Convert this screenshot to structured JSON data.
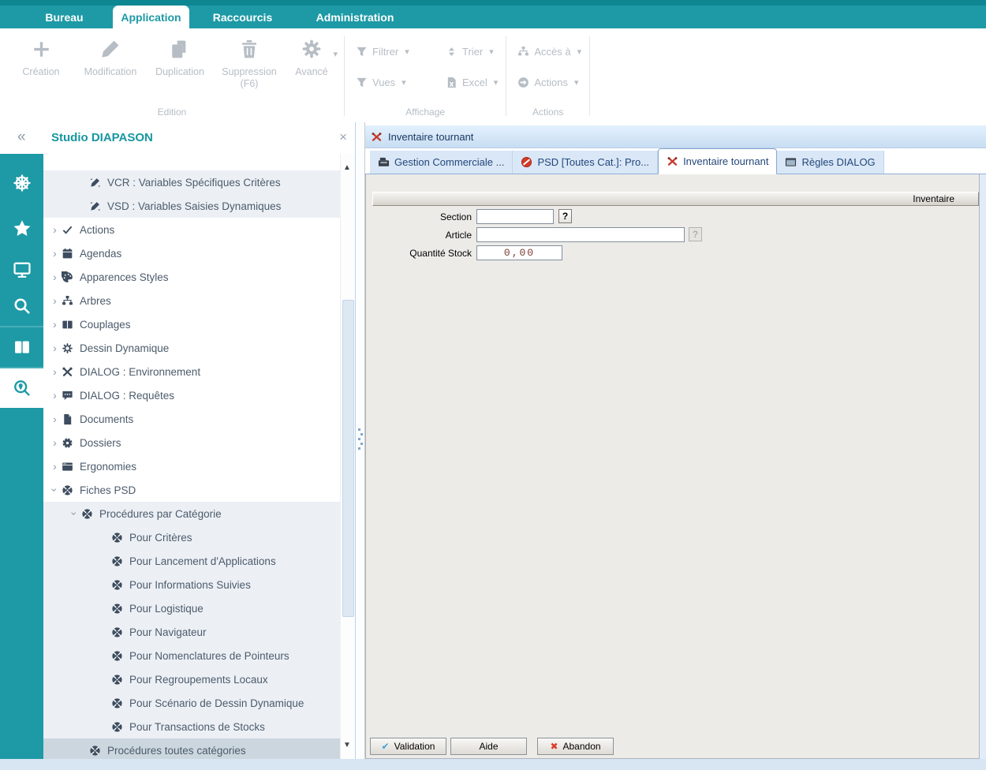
{
  "menu": {
    "tabs": [
      {
        "label": "Bureau",
        "active": false
      },
      {
        "label": "Application",
        "active": true
      },
      {
        "label": "Raccourcis",
        "active": false
      },
      {
        "label": "Administration",
        "active": false
      }
    ]
  },
  "toolbar": {
    "groups": [
      {
        "label": "Edition",
        "items": [
          {
            "label": "Création",
            "icon": "plus-icon",
            "symbol": "#i-plus"
          },
          {
            "label": "Modification",
            "icon": "pencil-icon",
            "symbol": "#i-pencil"
          },
          {
            "label": "Duplication",
            "icon": "duplicate-icon",
            "symbol": "#i-dup"
          },
          {
            "label": "Suppression",
            "sub": "(F6)",
            "icon": "trash-icon",
            "symbol": "#i-trash"
          },
          {
            "label": "Avancé",
            "icon": "gear-icon",
            "symbol": "#i-gear",
            "dropdown": "▾"
          }
        ]
      },
      {
        "label": "Affichage",
        "items": [
          {
            "label": "Filtrer",
            "icon": "filter-icon",
            "symbol": "#i-filter",
            "dropdown": "▾"
          },
          {
            "label": "Trier",
            "icon": "sort-icon",
            "symbol": "#i-sort",
            "dropdown": "▾"
          },
          {
            "label": "Vues",
            "icon": "filter-icon",
            "symbol": "#i-filter",
            "dropdown": "▾"
          },
          {
            "label": "Excel",
            "icon": "excel-icon",
            "symbol": "#i-excel",
            "dropdown": "▾"
          }
        ]
      },
      {
        "label": "Actions",
        "items": [
          {
            "label": "Accès à",
            "icon": "org-tree-icon",
            "symbol": "#i-orgtree",
            "dropdown": "▾"
          },
          {
            "label": "Actions",
            "icon": "arrow-circle-icon",
            "symbol": "#i-arrowc",
            "dropdown": "▾"
          }
        ]
      }
    ]
  },
  "sidebar": {
    "collapse_glyph": "«",
    "title": "Studio DIAPASON",
    "close_glyph": "×",
    "rail": [
      {
        "icon": "helm-icon",
        "symbol": "#i-helm",
        "active": false
      },
      {
        "icon": "star-icon",
        "symbol": "#i-star",
        "active": false
      },
      {
        "icon": "monitor-icon",
        "symbol": "#i-monitor",
        "active": false
      },
      {
        "icon": "search-icon",
        "symbol": "#i-search",
        "active": false
      },
      {
        "icon": "columns-icon",
        "symbol": "#i-cols",
        "active": false
      },
      {
        "icon": "search-pin-icon",
        "symbol": "#i-searchpin",
        "active": true
      }
    ],
    "scroll": {
      "up_glyph": "▲",
      "down_glyph": "▼"
    },
    "tree": [
      {
        "label": "VCR : Variables Spécifiques Critères",
        "icon": "i-vars",
        "level": "2c",
        "chevron": "",
        "state": "hl"
      },
      {
        "label": "VSD : Variables Saisies Dynamiques",
        "icon": "i-vars",
        "level": "2c",
        "chevron": "",
        "state": "hl"
      },
      {
        "label": "Actions",
        "icon": "i-check",
        "level": "1",
        "chevron": "right",
        "state": ""
      },
      {
        "label": "Agendas",
        "icon": "i-cal",
        "level": "1",
        "chevron": "right",
        "state": ""
      },
      {
        "label": "Apparences Styles",
        "icon": "i-palette",
        "level": "1",
        "chevron": "right",
        "state": ""
      },
      {
        "label": "Arbres",
        "icon": "i-orgtree",
        "level": "1",
        "chevron": "right",
        "state": ""
      },
      {
        "label": "Couplages",
        "icon": "i-cols2",
        "level": "1",
        "chevron": "right",
        "state": ""
      },
      {
        "label": "Dessin Dynamique",
        "icon": "i-gearo",
        "level": "1",
        "chevron": "right",
        "state": ""
      },
      {
        "label": "DIALOG : Environnement",
        "icon": "i-tools",
        "level": "1",
        "chevron": "right",
        "state": ""
      },
      {
        "label": "DIALOG : Requêtes",
        "icon": "i-chat",
        "level": "1",
        "chevron": "right",
        "state": ""
      },
      {
        "label": "Documents",
        "icon": "i-file",
        "level": "1",
        "chevron": "right",
        "state": ""
      },
      {
        "label": "Dossiers",
        "icon": "i-wheel",
        "level": "1",
        "chevron": "right",
        "state": ""
      },
      {
        "label": "Ergonomies",
        "icon": "i-window",
        "level": "1",
        "chevron": "right",
        "state": ""
      },
      {
        "label": "Fiches PSD",
        "icon": "i-psd",
        "level": "1",
        "chevron": "down",
        "state": ""
      },
      {
        "label": "Procédures par Catégorie",
        "icon": "i-psd",
        "level": "2",
        "chevron": "down",
        "state": "hl"
      },
      {
        "label": "Pour Critères",
        "icon": "i-psd",
        "level": "3",
        "chevron": "",
        "state": "hl"
      },
      {
        "label": "Pour Lancement d'Applications",
        "icon": "i-psd",
        "level": "3",
        "chevron": "",
        "state": "hl"
      },
      {
        "label": "Pour Informations Suivies",
        "icon": "i-psd",
        "level": "3",
        "chevron": "",
        "state": "hl"
      },
      {
        "label": "Pour Logistique",
        "icon": "i-psd",
        "level": "3",
        "chevron": "",
        "state": "hl"
      },
      {
        "label": "Pour Navigateur",
        "icon": "i-psd",
        "level": "3",
        "chevron": "",
        "state": "hl"
      },
      {
        "label": "Pour Nomenclatures de Pointeurs",
        "icon": "i-psd",
        "level": "3",
        "chevron": "",
        "state": "hl"
      },
      {
        "label": "Pour Regroupements Locaux",
        "icon": "i-psd",
        "level": "3",
        "chevron": "",
        "state": "hl"
      },
      {
        "label": "Pour Scénario de Dessin Dynamique",
        "icon": "i-psd",
        "level": "3",
        "chevron": "",
        "state": "hl"
      },
      {
        "label": "Pour Transactions de Stocks",
        "icon": "i-psd",
        "level": "3",
        "chevron": "",
        "state": "hl"
      },
      {
        "label": "Procédures toutes catégories",
        "icon": "i-psd",
        "level": "2c",
        "chevron": "",
        "state": "sel"
      }
    ]
  },
  "main": {
    "window_title": "Inventaire tournant",
    "window_icon": "inventory-tools-icon",
    "tabs": [
      {
        "label": "Gestion Commerciale ...",
        "icon": "register-icon",
        "symbol": "#i-register",
        "active": false
      },
      {
        "label": "PSD [Toutes Cat.]: Pro...",
        "icon": "no-entry-icon",
        "symbol": "#i-noentry",
        "active": false
      },
      {
        "label": "Inventaire tournant",
        "icon": "inventory-tools-icon",
        "symbol": "#i-invtools",
        "active": true
      },
      {
        "label": "Règles DIALOG",
        "icon": "console-icon",
        "symbol": "#i-console",
        "active": false
      }
    ],
    "form": {
      "group_title": "Inventaire",
      "fields": [
        {
          "label": "Section",
          "value": "",
          "help_button": "?",
          "help_enabled": true
        },
        {
          "label": "Article",
          "value": "",
          "help_button": "?",
          "help_enabled": false
        },
        {
          "label": "Quantité Stock",
          "value": "0,00"
        }
      ]
    },
    "buttons": [
      {
        "label": "Validation",
        "glyph": "✔",
        "icon": "check-icon"
      },
      {
        "label": "Aide",
        "glyph": "",
        "icon": ""
      },
      {
        "label": "Abandon",
        "glyph": "✖",
        "icon": "x-icon"
      }
    ]
  },
  "colors": {
    "teal": "#1d9aa6",
    "teal_dark": "#0f8793",
    "title_bar_blue": "#c8ddf2",
    "tab_text_blue": "#24477a",
    "content_gray": "#ecebe8",
    "tree_highlight": "#ecf0f5",
    "tree_selected": "#ccd6df",
    "danger_red": "#d9402a",
    "check_blue": "#3fa3d7",
    "qty_text": "#7a3b35"
  }
}
